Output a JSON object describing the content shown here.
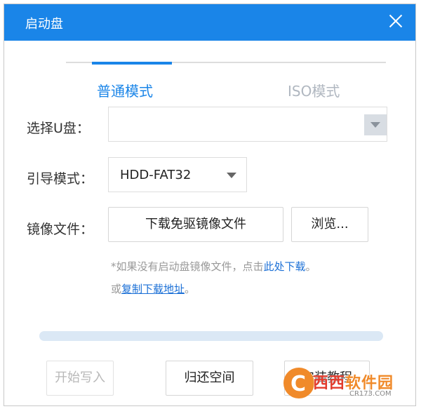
{
  "window": {
    "title": "启动盘"
  },
  "tabs": [
    {
      "label": "普通模式",
      "active": true
    },
    {
      "label": "ISO模式",
      "active": false
    }
  ],
  "form": {
    "disk_label": "选择U盘：",
    "disk_value": "",
    "boot_label": "引导模式：",
    "boot_value": "HDD-FAT32",
    "image_label": "镜像文件：",
    "download_button": "下载免驱镜像文件",
    "browse_button": "浏览..."
  },
  "hint": {
    "line1_prefix": "*如果没有启动盘镜像文件，点击",
    "line1_link": "此处下载",
    "line1_suffix": "。",
    "line2_prefix": "或",
    "line2_link": "复制下载地址",
    "line2_suffix": "。"
  },
  "progress": {
    "value": 0
  },
  "buttons": {
    "start": "开始写入",
    "restore": "归还空间",
    "tutorial": "安装教程"
  },
  "watermark": {
    "brand_red": "西西",
    "brand_orange": "软件园",
    "domain": "CR173.COM"
  },
  "colors": {
    "accent": "#1a85e8",
    "link": "#1a6fd6",
    "disabled": "#b8b8b8"
  }
}
